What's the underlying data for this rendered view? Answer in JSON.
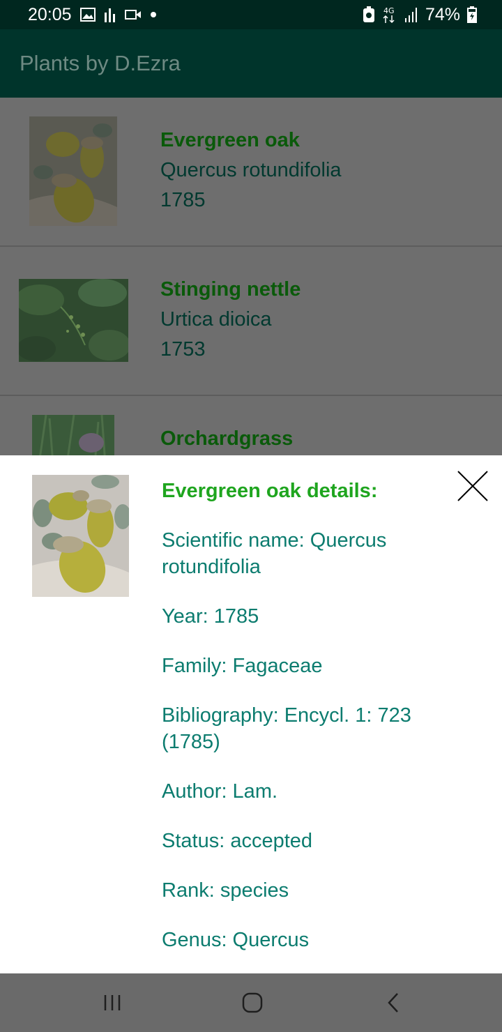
{
  "status_bar": {
    "time": "20:05",
    "battery": "74%",
    "network": "4G"
  },
  "app_bar": {
    "title": "Plants by D.Ezra"
  },
  "list": {
    "items": [
      {
        "name": "Evergreen oak",
        "scientific": "Quercus rotundifolia",
        "year": "1785",
        "image": "acorn-photo"
      },
      {
        "name": "Stinging nettle",
        "scientific": "Urtica dioica",
        "year": "1753",
        "image": "nettle-photo"
      },
      {
        "name": "Orchardgrass",
        "scientific": "",
        "year": "",
        "image": "grass-photo"
      }
    ]
  },
  "details": {
    "title": "Evergreen oak details:",
    "image": "acorn-photo",
    "rows": [
      "Scientific name: Quercus rotundifolia",
      "Year: 1785",
      "Family: Fagaceae",
      "Bibliography: Encycl. 1: 723 (1785)",
      "Author: Lam.",
      "Status: accepted",
      "Rank: species",
      "Genus: Quercus"
    ],
    "close_icon": "close-icon"
  },
  "nav_bar": {
    "buttons": [
      "recent-apps-icon",
      "home-icon",
      "back-icon"
    ]
  },
  "colors": {
    "app_bar": "#00342b",
    "status_bar": "#00271f",
    "title_green": "#1fa51f",
    "detail_teal": "#0c7c6f"
  }
}
